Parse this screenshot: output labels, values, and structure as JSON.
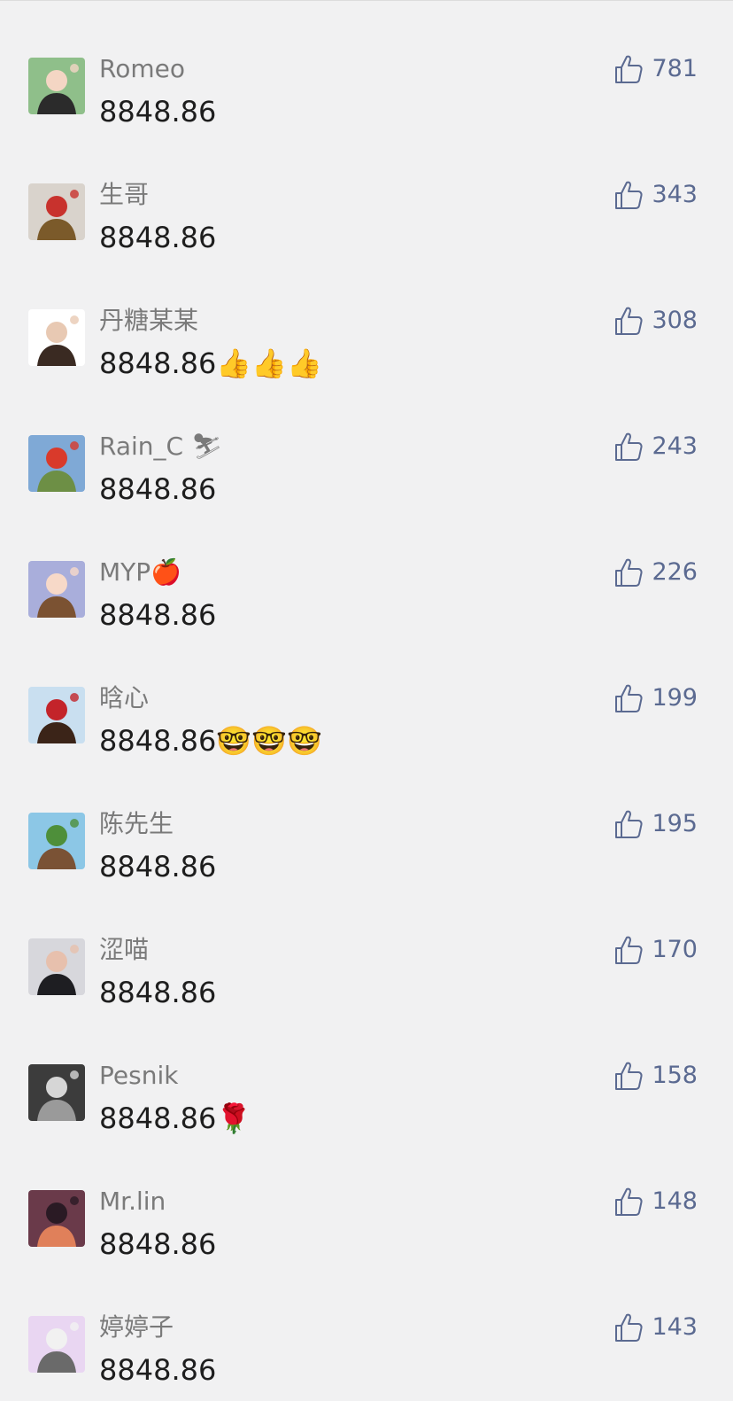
{
  "comments": [
    {
      "name": "Romeo",
      "text": "8848.86",
      "likes": "781",
      "avatar": {
        "bg": "#8fbf8a",
        "fg": "#2b2b2b",
        "accent": "#f4d6c4"
      }
    },
    {
      "name": "生哥",
      "text": "8848.86",
      "likes": "343",
      "avatar": {
        "bg": "#d9d3cc",
        "fg": "#7b5a2a",
        "accent": "#c8322d"
      }
    },
    {
      "name": "丹糖某某",
      "text": "8848.86👍👍👍",
      "likes": "308",
      "avatar": {
        "bg": "#ffffff",
        "fg": "#3a2a22",
        "accent": "#e8c9b3"
      }
    },
    {
      "name": "Rain_C ⛷",
      "text": "8848.86",
      "likes": "243",
      "avatar": {
        "bg": "#7fa9d6",
        "fg": "#6d8f45",
        "accent": "#d93a2b"
      }
    },
    {
      "name": "MYP🍎",
      "text": "8848.86",
      "likes": "226",
      "avatar": {
        "bg": "#a9aedb",
        "fg": "#7b5232",
        "accent": "#f7d9c8"
      }
    },
    {
      "name": "晗心",
      "text": "8848.86🤓🤓🤓",
      "likes": "199",
      "avatar": {
        "bg": "#c9dff0",
        "fg": "#3b2418",
        "accent": "#c3242a"
      }
    },
    {
      "name": "陈先生",
      "text": "8848.86",
      "likes": "195",
      "avatar": {
        "bg": "#8cc7e6",
        "fg": "#7a5235",
        "accent": "#4e8f3a"
      }
    },
    {
      "name": "涩喵",
      "text": "8848.86",
      "likes": "170",
      "avatar": {
        "bg": "#d7d7dc",
        "fg": "#1e1e22",
        "accent": "#e7c0ad"
      }
    },
    {
      "name": "Pesnik",
      "text": "8848.86🌹",
      "likes": "158",
      "avatar": {
        "bg": "#3c3c3c",
        "fg": "#9a9a9a",
        "accent": "#d6d6d6"
      }
    },
    {
      "name": "Mr.lin",
      "text": "8848.86",
      "likes": "148",
      "avatar": {
        "bg": "#6a3a4a",
        "fg": "#e0805a",
        "accent": "#2a1a24"
      }
    },
    {
      "name": "婷婷子",
      "text": "8848.86",
      "likes": "143",
      "avatar": {
        "bg": "#e9d6f2",
        "fg": "#6a6a6a",
        "accent": "#f1f1f1"
      }
    }
  ],
  "like_icon": "thumbs-up-outline-icon",
  "colors": {
    "background": "#f1f1f2",
    "name": "#7a7a7a",
    "text": "#1e1e1e",
    "like": "#5b6a91"
  }
}
